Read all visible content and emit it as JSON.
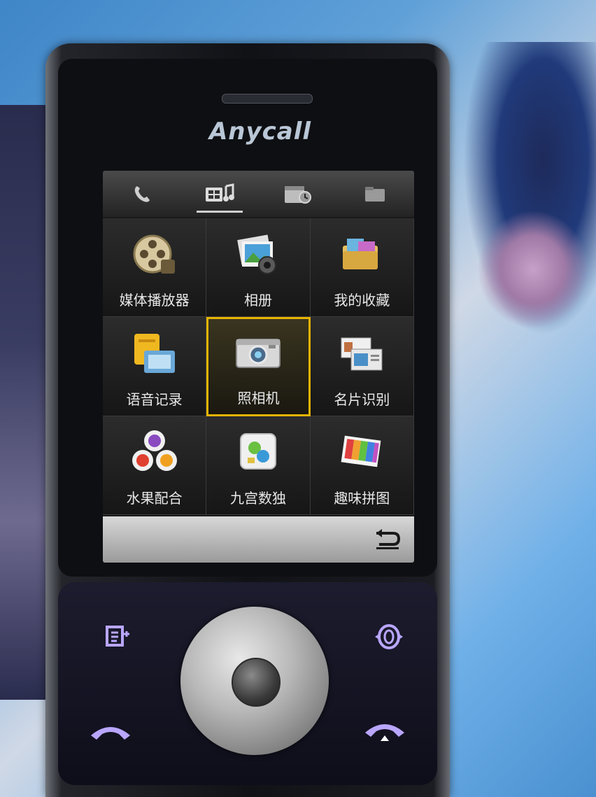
{
  "brand": "Anycall",
  "tabs": [
    {
      "icon": "phone-icon",
      "active": false
    },
    {
      "icon": "multimedia-icon",
      "active": true
    },
    {
      "icon": "calendar-icon",
      "active": false
    },
    {
      "icon": "folder-icon",
      "active": false
    }
  ],
  "menu": {
    "items": [
      {
        "label": "媒体播放器",
        "icon": "media-player-icon"
      },
      {
        "label": "相册",
        "icon": "album-icon"
      },
      {
        "label": "我的收藏",
        "icon": "my-favorites-icon"
      },
      {
        "label": "语音记录",
        "icon": "voice-recorder-icon"
      },
      {
        "label": "照相机",
        "icon": "camera-icon",
        "selected": true
      },
      {
        "label": "名片识别",
        "icon": "business-card-icon"
      },
      {
        "label": "水果配合",
        "icon": "fruit-game-icon"
      },
      {
        "label": "九宫数独",
        "icon": "sudoku-icon"
      },
      {
        "label": "趣味拼图",
        "icon": "puzzle-icon"
      }
    ]
  },
  "softkey": {
    "icon": "back-icon"
  },
  "keys": {
    "left_soft": "message-icon",
    "right_soft": "sync-icon",
    "call": "call-icon",
    "end": "end-call-icon"
  },
  "colors": {
    "selection": "#e6b400",
    "key_glow": "#b9a6ff"
  }
}
